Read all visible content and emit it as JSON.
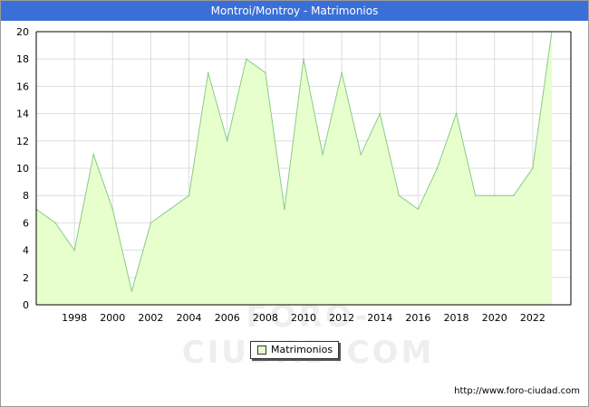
{
  "header": {
    "title": "Montroi/Montroy - Matrimonios"
  },
  "watermark": "FORO-CIUDAD.COM",
  "source_url": "http://www.foro-ciudad.com",
  "chart_data": {
    "type": "area",
    "title": "Montroi/Montroy - Matrimonios",
    "xlabel": "",
    "ylabel": "",
    "x": [
      1996,
      1997,
      1998,
      1999,
      2000,
      2001,
      2002,
      2003,
      2004,
      2005,
      2006,
      2007,
      2008,
      2009,
      2010,
      2011,
      2012,
      2013,
      2014,
      2015,
      2016,
      2017,
      2018,
      2019,
      2020,
      2021,
      2022,
      2023
    ],
    "series": [
      {
        "name": "Matrimonios",
        "values": [
          7,
          6,
          4,
          11,
          7,
          1,
          6,
          7,
          8,
          17,
          12,
          18,
          17,
          7,
          18,
          11,
          17,
          11,
          14,
          8,
          7,
          10,
          14,
          8,
          8,
          8,
          10,
          20
        ]
      }
    ],
    "xlim": [
      1996,
      2024
    ],
    "ylim": [
      0,
      20
    ],
    "x_ticks": [
      "1998",
      "2000",
      "2002",
      "2004",
      "2006",
      "2008",
      "2010",
      "2012",
      "2014",
      "2016",
      "2018",
      "2020",
      "2022"
    ],
    "y_ticks": [
      "0",
      "2",
      "4",
      "6",
      "8",
      "10",
      "12",
      "14",
      "16",
      "18",
      "20"
    ],
    "grid": true,
    "legend_position": "bottom-center",
    "colors": {
      "fill": "#e6ffcc",
      "line": "#88cc88",
      "grid": "#dddddd",
      "axis": "#000000",
      "title_bar": "#3a6fd8"
    }
  }
}
